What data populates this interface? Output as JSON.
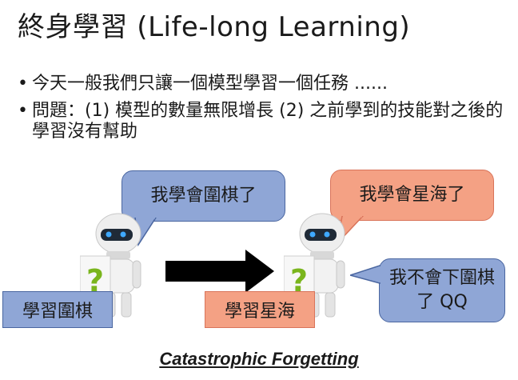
{
  "title": "終身學習 (Life-long Learning)",
  "bullets": [
    "今天一般我們只讓一個模型學習一個任務 ......",
    "問題：(1) 模型的數量無限增長 (2) 之前學到的技能對之後的學習沒有幫助"
  ],
  "robot1": {
    "bubble": "我學會圍棋了",
    "label": "學習圍棋"
  },
  "robot2": {
    "bubble_top": "我學會星海了",
    "bubble_right": "我不會下圍棋了 QQ",
    "label": "學習星海"
  },
  "footer": "Catastrophic Forgetting",
  "colors": {
    "blue_bubble": "#8fa6d6",
    "orange_bubble": "#f4a184",
    "arrow": "#000000"
  },
  "icons": [
    "robot-icon",
    "robot-icon",
    "question-mark-sign-icon",
    "arrow-right-icon"
  ]
}
